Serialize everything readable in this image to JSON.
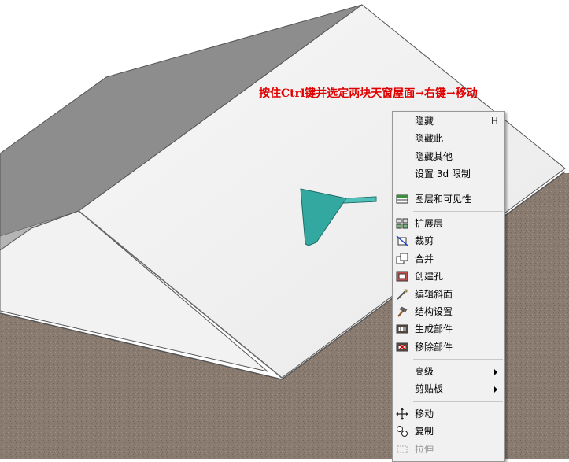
{
  "annotation": {
    "text": "按住Ctrl键并选定两块天窗屋面→右键→移动",
    "color": "#e00000"
  },
  "colors": {
    "roof_light": "#f0f0f0",
    "roof_dark": "#8a8a8a",
    "wall": "#8a7a70",
    "dormer": "#33a8a0",
    "menu_bg": "#f1f1f1",
    "arrow": "#e00000"
  },
  "menu": {
    "items": [
      {
        "label": "隐藏",
        "shortcut": "H",
        "icon": "none"
      },
      {
        "label": "隐藏此",
        "icon": "none"
      },
      {
        "label": "隐藏其他",
        "icon": "none"
      },
      {
        "label": "设置 3d 限制",
        "icon": "none"
      },
      {
        "label": "图层和可见性",
        "icon": "layers-icon"
      },
      {
        "label": "扩展层",
        "icon": "extend-layer-icon"
      },
      {
        "label": "裁剪",
        "icon": "trim-icon"
      },
      {
        "label": "合并",
        "icon": "merge-icon"
      },
      {
        "label": "创建孔",
        "icon": "create-hole-icon"
      },
      {
        "label": "编辑斜面",
        "icon": "edit-bevel-icon"
      },
      {
        "label": "结构设置",
        "icon": "hammer-icon"
      },
      {
        "label": "生成部件",
        "icon": "generate-part-icon"
      },
      {
        "label": "移除部件",
        "icon": "remove-part-icon"
      },
      {
        "label": "高级",
        "icon": "none",
        "submenu": true
      },
      {
        "label": "剪贴板",
        "icon": "none",
        "submenu": true
      },
      {
        "label": "移动",
        "icon": "move-icon"
      },
      {
        "label": "复制",
        "icon": "copy-icon"
      },
      {
        "label": "拉伸",
        "icon": "stretch-icon",
        "disabled": true
      }
    ]
  }
}
